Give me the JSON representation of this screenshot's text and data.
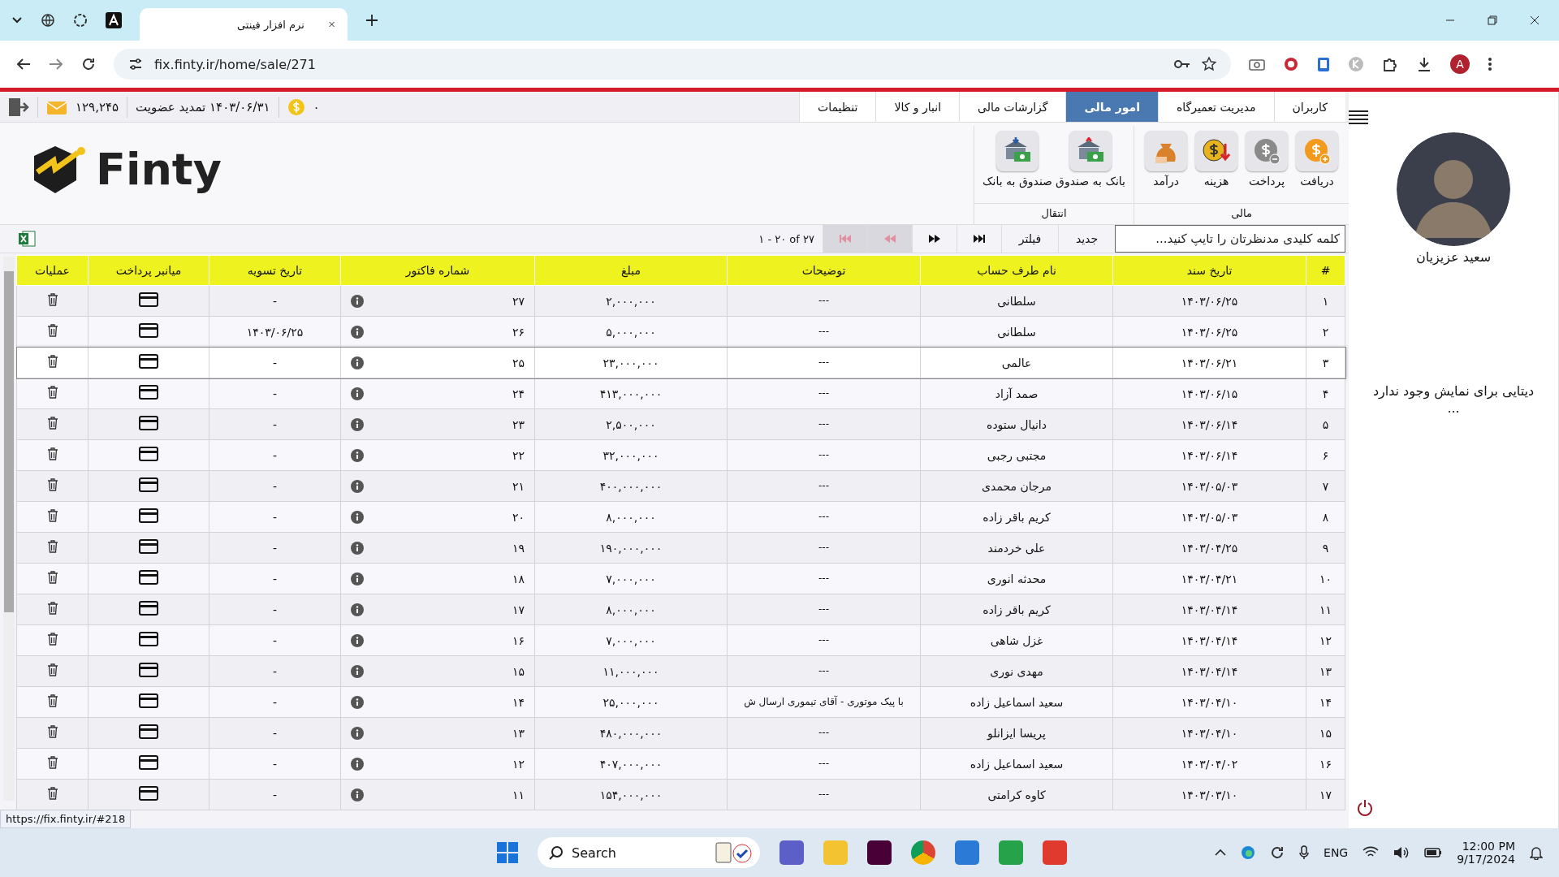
{
  "browser": {
    "tab_title": "نرم افزار فینتی",
    "url": "fix.finty.ir/home/sale/271",
    "profile_initial": "A"
  },
  "status": {
    "balance": "۱۲۹,۲۴۵",
    "membership": "۱۴۰۳/۰۶/۳۱ تمدید عضویت",
    "coins": "۰"
  },
  "menu_tabs": [
    {
      "label": "کاربران",
      "selected": false
    },
    {
      "label": "مدیریت تعمیرگاه",
      "selected": false
    },
    {
      "label": "امور مالی",
      "selected": true
    },
    {
      "label": "گزارشات مالی",
      "selected": false
    },
    {
      "label": "انبار و کالا",
      "selected": false
    },
    {
      "label": "تنظیمات",
      "selected": false
    }
  ],
  "logo_text": "Finty",
  "toolbar_groups": [
    {
      "label": "مالی",
      "items": [
        {
          "label": "دریافت",
          "kind": "receive"
        },
        {
          "label": "پرداخت",
          "kind": "pay"
        },
        {
          "label": "هزینه",
          "kind": "expense"
        },
        {
          "label": "درآمد",
          "kind": "income"
        }
      ]
    },
    {
      "label": "انتقال",
      "items": [
        {
          "label": "بانک به صندوق",
          "kind": "bank_to_cash"
        },
        {
          "label": "صندوق به بانک",
          "kind": "cash_to_bank"
        }
      ]
    }
  ],
  "search": {
    "placeholder": "کلمه کلیدی مدنظرتان را تایپ کنید..."
  },
  "buttons": [
    "جدید",
    "فیلتر"
  ],
  "pager": [
    {
      "kind": "last",
      "disabled": false
    },
    {
      "kind": "next",
      "disabled": false
    },
    {
      "kind": "previous",
      "disabled": true
    },
    {
      "kind": "first",
      "disabled": true
    }
  ],
  "range": "۱ - ۲۰ of ۲۷",
  "table": {
    "columns": [
      "#",
      "تاریخ سند",
      "نام طرف حساب",
      "توضیحات",
      "مبلغ",
      "شماره فاکتور",
      "تاریخ تسویه",
      "میانبر پرداخت",
      "عملیات"
    ],
    "rows": [
      {
        "number": "۱",
        "doc_date": "۱۴۰۳/۰۶/۲۵",
        "account": "سلطانی",
        "description": "---",
        "amount": "۲,۰۰۰,۰۰۰",
        "invoice": "۲۷",
        "settlement": "-",
        "selected": false
      },
      {
        "number": "۲",
        "doc_date": "۱۴۰۳/۰۶/۲۵",
        "account": "سلطانی",
        "description": "---",
        "amount": "۵,۰۰۰,۰۰۰",
        "invoice": "۲۶",
        "settlement": "۱۴۰۳/۰۶/۲۵",
        "selected": false
      },
      {
        "number": "۳",
        "doc_date": "۱۴۰۳/۰۶/۲۱",
        "account": "عالمی",
        "description": "---",
        "amount": "۲۳,۰۰۰,۰۰۰",
        "invoice": "۲۵",
        "settlement": "-",
        "selected": true
      },
      {
        "number": "۴",
        "doc_date": "۱۴۰۳/۰۶/۱۵",
        "account": "صمد آزاد",
        "description": "---",
        "amount": "۴۱۳,۰۰۰,۰۰۰",
        "invoice": "۲۴",
        "settlement": "-",
        "selected": false
      },
      {
        "number": "۵",
        "doc_date": "۱۴۰۳/۰۶/۱۴",
        "account": "دانیال ستوده",
        "description": "---",
        "amount": "۲,۵۰۰,۰۰۰",
        "invoice": "۲۳",
        "settlement": "-",
        "selected": false
      },
      {
        "number": "۶",
        "doc_date": "۱۴۰۳/۰۶/۱۴",
        "account": "مجتبی رجبی",
        "description": "---",
        "amount": "۳۲,۰۰۰,۰۰۰",
        "invoice": "۲۲",
        "settlement": "-",
        "selected": false
      },
      {
        "number": "۷",
        "doc_date": "۱۴۰۳/۰۵/۰۳",
        "account": "مرجان محمدی",
        "description": "---",
        "amount": "۴۰۰,۰۰۰,۰۰۰",
        "invoice": "۲۱",
        "settlement": "-",
        "selected": false
      },
      {
        "number": "۸",
        "doc_date": "۱۴۰۳/۰۵/۰۳",
        "account": "کریم باقر زاده",
        "description": "---",
        "amount": "۸,۰۰۰,۰۰۰",
        "invoice": "۲۰",
        "settlement": "-",
        "selected": false
      },
      {
        "number": "۹",
        "doc_date": "۱۴۰۳/۰۴/۲۵",
        "account": "علی خردمند",
        "description": "---",
        "amount": "۱۹۰,۰۰۰,۰۰۰",
        "invoice": "۱۹",
        "settlement": "-",
        "selected": false
      },
      {
        "number": "۱۰",
        "doc_date": "۱۴۰۳/۰۴/۲۱",
        "account": "محدثه انوری",
        "description": "---",
        "amount": "۷,۰۰۰,۰۰۰",
        "invoice": "۱۸",
        "settlement": "-",
        "selected": false
      },
      {
        "number": "۱۱",
        "doc_date": "۱۴۰۳/۰۴/۱۴",
        "account": "کریم باقر زاده",
        "description": "---",
        "amount": "۸,۰۰۰,۰۰۰",
        "invoice": "۱۷",
        "settlement": "-",
        "selected": false
      },
      {
        "number": "۱۲",
        "doc_date": "۱۴۰۳/۰۴/۱۴",
        "account": "غزل شاهی",
        "description": "---",
        "amount": "۷,۰۰۰,۰۰۰",
        "invoice": "۱۶",
        "settlement": "-",
        "selected": false
      },
      {
        "number": "۱۳",
        "doc_date": "۱۴۰۳/۰۴/۱۴",
        "account": "مهدی نوری",
        "description": "---",
        "amount": "۱۱,۰۰۰,۰۰۰",
        "invoice": "۱۵",
        "settlement": "-",
        "selected": false
      },
      {
        "number": "۱۴",
        "doc_date": "۱۴۰۳/۰۴/۱۰",
        "account": "سعید اسماعیل زاده",
        "description": "با پیک موتوری - آقای تیموری ارسال ش",
        "amount": "۲۵,۰۰۰,۰۰۰",
        "invoice": "۱۴",
        "settlement": "-",
        "selected": false
      },
      {
        "number": "۱۵",
        "doc_date": "۱۴۰۳/۰۴/۱۰",
        "account": "پریسا ایزانلو",
        "description": "---",
        "amount": "۴۸۰,۰۰۰,۰۰۰",
        "invoice": "۱۳",
        "settlement": "-",
        "selected": false
      },
      {
        "number": "۱۶",
        "doc_date": "۱۴۰۳/۰۴/۰۲",
        "account": "سعید اسماعیل زاده",
        "description": "---",
        "amount": "۴۰۷,۰۰۰,۰۰۰",
        "invoice": "۱۲",
        "settlement": "-",
        "selected": false
      },
      {
        "number": "۱۷",
        "doc_date": "۱۴۰۳/۰۳/۱۰",
        "account": "کاوه کرامتی",
        "description": "---",
        "amount": "۱۵۴,۰۰۰,۰۰۰",
        "invoice": "۱۱",
        "settlement": "-",
        "selected": false
      }
    ]
  },
  "sidebar": {
    "user_name": "سعید عزیزیان",
    "empty_message": "دیتایی برای نمایش وجود ندارد",
    "empty_ellipsis": "..."
  },
  "status_url": "https://fix.finty.ir/#218",
  "taskbar": {
    "search_label": "Search",
    "language": "ENG",
    "time": "12:00 PM",
    "date": "9/17/2024"
  }
}
